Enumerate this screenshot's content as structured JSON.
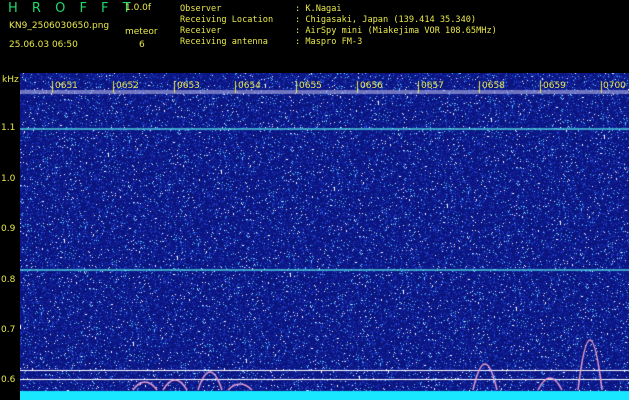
{
  "header": {
    "app_title": "H R O F F T",
    "version": "1.0.0f",
    "filename": "KN9_2506030650.png",
    "timestamp": "25.06.03 06:50",
    "meteor_label": "meteor",
    "meteor_count": "6"
  },
  "info": [
    {
      "label": "Observer",
      "value": "K.Nagai"
    },
    {
      "label": "Receiving Location",
      "value": "Chigasaki, Japan (139.414 35.340)"
    },
    {
      "label": "Receiver",
      "value": "AirSpy mini (Miakejima VOR 108.65MHz)"
    },
    {
      "label": "Receiving antenna",
      "value": "Maspro FM-3"
    }
  ],
  "y_axis": {
    "unit": "kHz",
    "ticks": [
      "1.1",
      "1.0",
      "0.9",
      "0.8",
      "0.7",
      "0.6"
    ]
  },
  "time_axis": {
    "labels": [
      "0651",
      "0652",
      "0653",
      "0654",
      "0655",
      "0656",
      "0657",
      "0658",
      "0659",
      "0700"
    ]
  },
  "colors": {
    "background": "#0b1580",
    "text": "#e8e84a",
    "title": "#21d86a",
    "bottom_band": "#19e6ff"
  }
}
